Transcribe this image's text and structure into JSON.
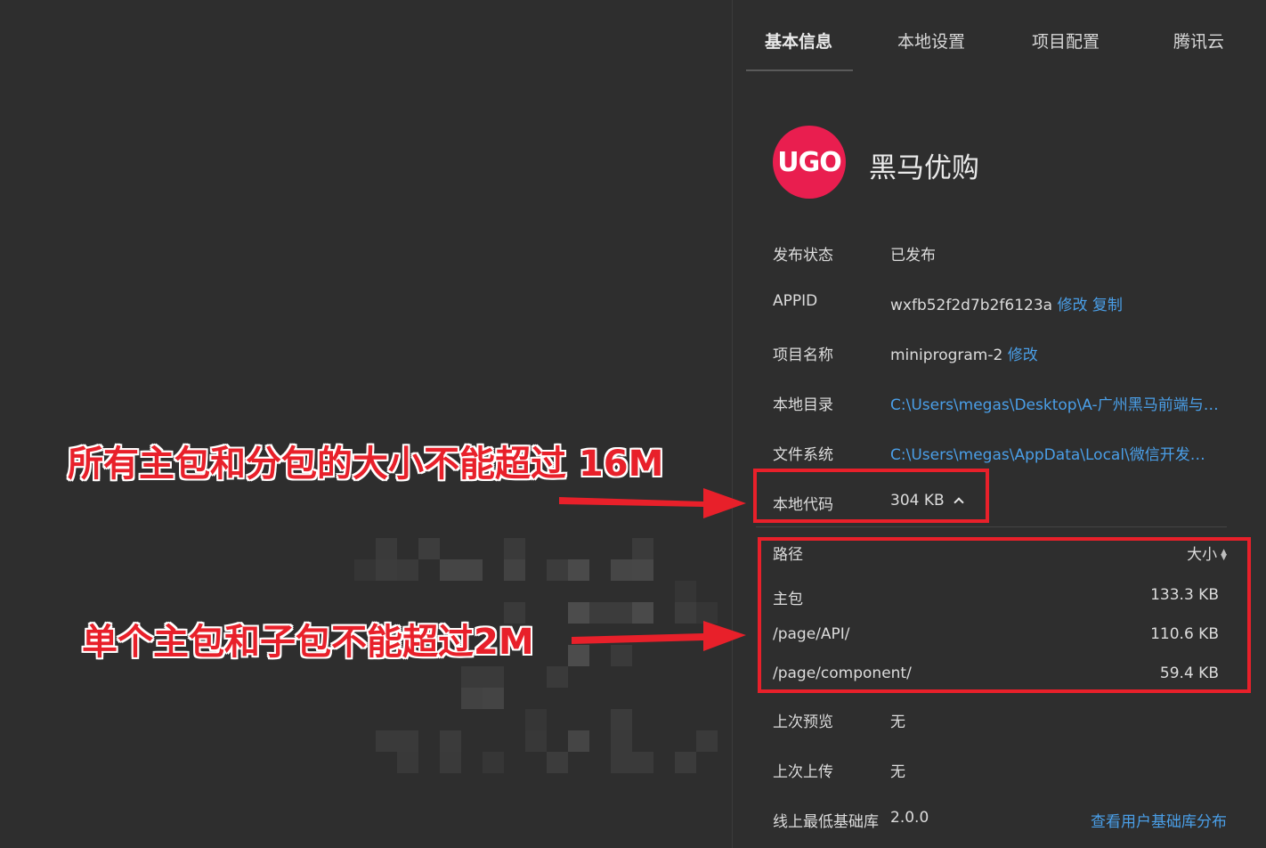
{
  "tabs": [
    {
      "label": "基本信息",
      "active": true
    },
    {
      "label": "本地设置",
      "active": false
    },
    {
      "label": "项目配置",
      "active": false
    },
    {
      "label": "腾讯云",
      "active": false
    }
  ],
  "app": {
    "logo_text": "UGO",
    "name": "黑马优购"
  },
  "info": {
    "publish_status": {
      "label": "发布状态",
      "value": "已发布"
    },
    "appid": {
      "label": "APPID",
      "value": "wxfb52f2d7b2f6123a",
      "modify": "修改",
      "copy": "复制"
    },
    "project_name": {
      "label": "项目名称",
      "value": "miniprogram-2",
      "modify": "修改"
    },
    "local_dir": {
      "label": "本地目录",
      "value": "C:\\Users\\megas\\Desktop\\A-广州黑马前端与移动开发"
    },
    "file_system": {
      "label": "文件系统",
      "value": "C:\\Users\\megas\\AppData\\Local\\微信开发者工具"
    },
    "local_code": {
      "label": "本地代码",
      "value": "304 KB"
    }
  },
  "package_table": {
    "path_header": "路径",
    "size_header": "大小",
    "rows": [
      {
        "path": "主包",
        "size": "133.3 KB"
      },
      {
        "path": "/page/API/",
        "size": "110.6 KB"
      },
      {
        "path": "/page/component/",
        "size": "59.4 KB"
      }
    ]
  },
  "last_preview": {
    "label": "上次预览",
    "value": "无"
  },
  "last_upload": {
    "label": "上次上传",
    "value": "无"
  },
  "min_lib": {
    "label": "线上最低基础库",
    "value": "2.0.0",
    "link": "查看用户基础库分布"
  },
  "annotations": {
    "total_limit": "所有主包和分包的大小不能超过 16M",
    "single_limit": "单个主包和子包不能超过2M"
  },
  "colors": {
    "accent_link": "#4a9fe8",
    "annotation_red": "#e8202a",
    "logo": "#e91e4f",
    "background": "#2e2e2e"
  }
}
